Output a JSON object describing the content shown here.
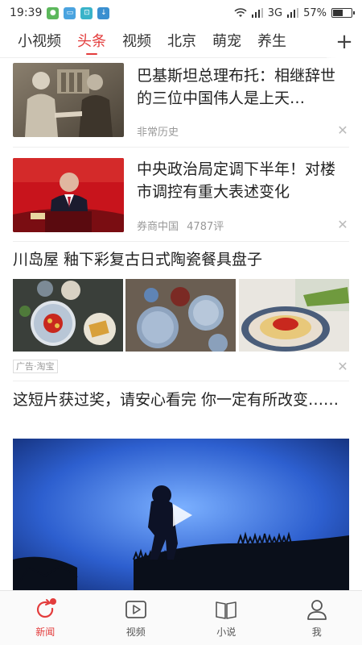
{
  "status_bar": {
    "time": "19:39",
    "network": "3G",
    "battery": "57%",
    "battery_level": 0.57
  },
  "tabs": {
    "items": [
      {
        "label": "小视频",
        "active": false
      },
      {
        "label": "头条",
        "active": true
      },
      {
        "label": "视频",
        "active": false
      },
      {
        "label": "北京",
        "active": false
      },
      {
        "label": "萌宠",
        "active": false
      },
      {
        "label": "养生",
        "active": false
      }
    ],
    "add_icon": "plus-icon"
  },
  "feed": {
    "articles": [
      {
        "title": "巴基斯坦总理布托：相继辞世的三位中国伟人是上天…",
        "source": "非常历史",
        "comments": ""
      },
      {
        "title": "中央政治局定调下半年！对楼市调控有重大表述变化",
        "source": "券商中国",
        "comments": "4787评"
      }
    ],
    "ad": {
      "title": "川岛屋 釉下彩复古日式陶瓷餐具盘子",
      "tag": "广告·淘宝"
    },
    "video": {
      "title": "这短片获过奖，请安心看完 你一定有所改变……"
    }
  },
  "bottom_nav": {
    "items": [
      {
        "label": "新闻",
        "icon": "refresh-icon",
        "active": true
      },
      {
        "label": "视频",
        "icon": "play-box-icon",
        "active": false
      },
      {
        "label": "小说",
        "icon": "book-icon",
        "active": false
      },
      {
        "label": "我",
        "icon": "person-icon",
        "active": false
      }
    ]
  },
  "colors": {
    "accent": "#e33c3c"
  }
}
